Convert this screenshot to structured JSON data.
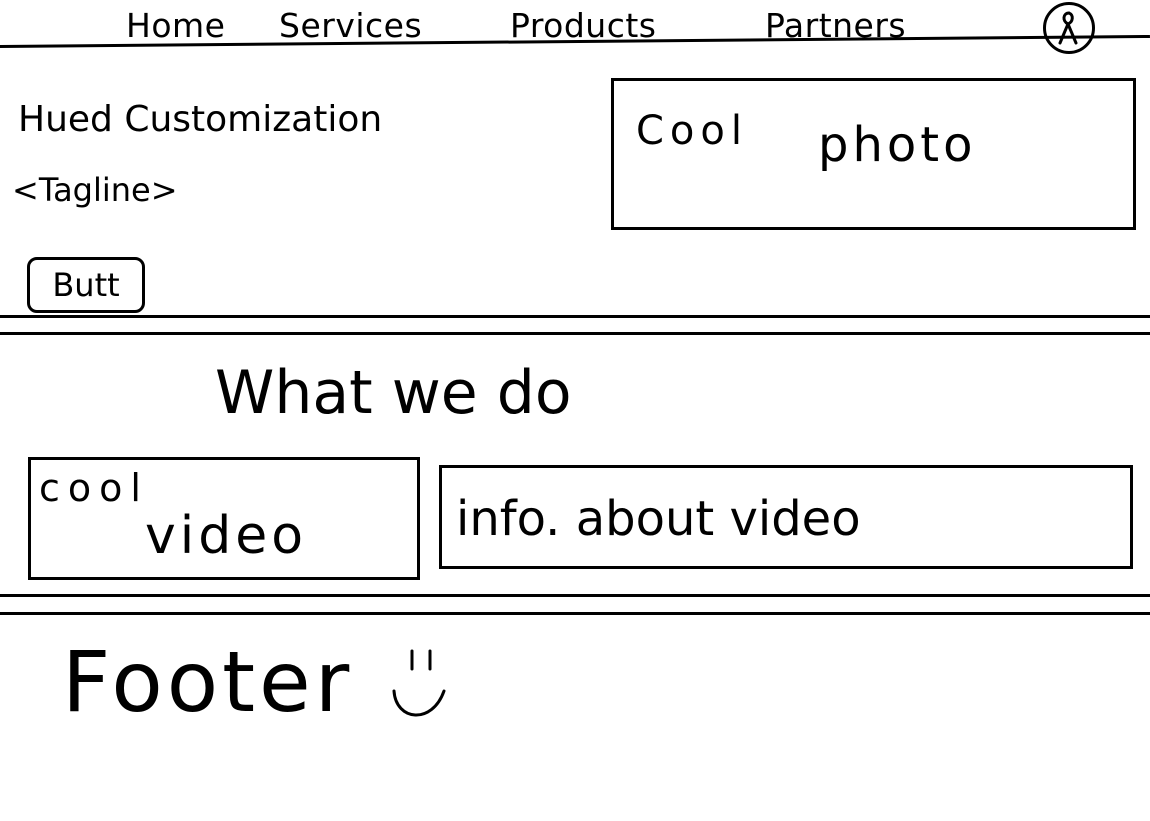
{
  "nav": {
    "items": [
      {
        "label": "Home"
      },
      {
        "label": "Services"
      },
      {
        "label": "Products"
      },
      {
        "label": "Partners"
      }
    ],
    "profile_icon": "user-account-icon"
  },
  "hero": {
    "title": "Hued Customization",
    "tagline": "<Tagline>",
    "button_label": "Butt",
    "photo": {
      "cool": "Cool",
      "word": "photo"
    }
  },
  "what_we_do": {
    "heading": "What we do",
    "video": {
      "cool": "cool",
      "word": "video"
    },
    "info": "info. about video"
  },
  "footer": {
    "label": "Footer",
    "emoji": "smiley-face-icon"
  }
}
